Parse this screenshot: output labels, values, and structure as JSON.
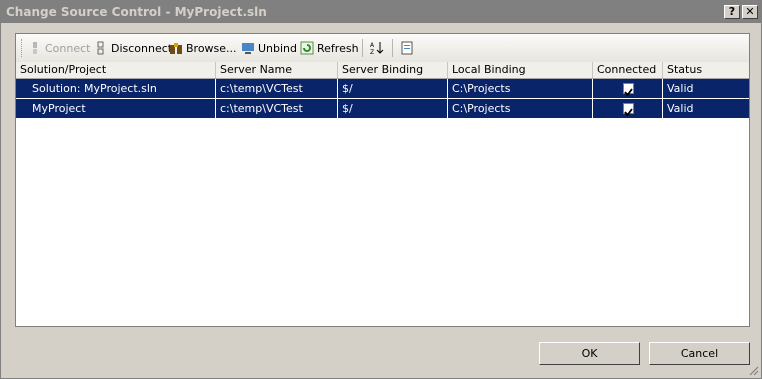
{
  "window": {
    "title": "Change Source Control - MyProject.sln",
    "help_label": "?",
    "close_label": "✕"
  },
  "toolbar": {
    "connect": "Connect",
    "disconnect": "Disconnect",
    "browse": "Browse...",
    "unbind": "Unbind",
    "refresh": "Refresh"
  },
  "table": {
    "columns": [
      "Solution/Project",
      "Server Name",
      "Server Binding",
      "Local Binding",
      "Connected",
      "Status"
    ],
    "rows": [
      {
        "name": "Solution: MyProject.sln",
        "server_name": "c:\\temp\\VCTest",
        "server_binding": "$/",
        "local_binding": "C:\\Projects",
        "connected": true,
        "status": "Valid"
      },
      {
        "name": "MyProject",
        "server_name": "c:\\temp\\VCTest",
        "server_binding": "$/",
        "local_binding": "C:\\Projects",
        "connected": true,
        "status": "Valid"
      }
    ]
  },
  "buttons": {
    "ok": "OK",
    "cancel": "Cancel"
  },
  "colors": {
    "selection": "#0a246a",
    "dialog": "#d4d0c8"
  }
}
